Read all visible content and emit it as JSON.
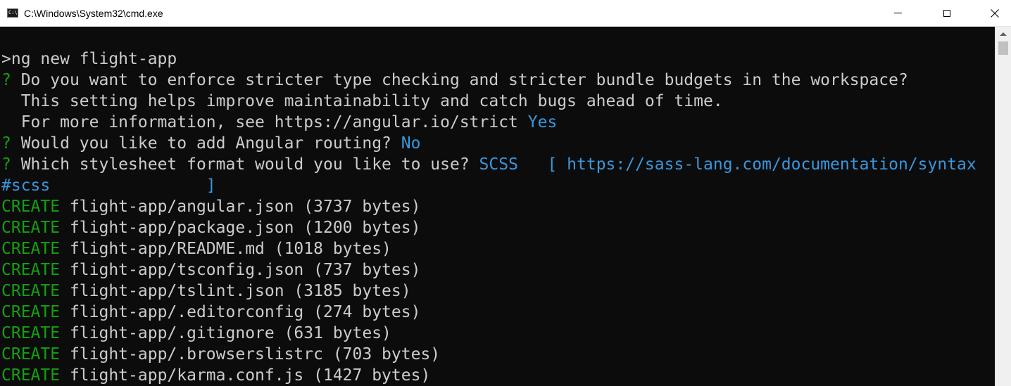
{
  "window": {
    "title": "C:\\Windows\\System32\\cmd.exe",
    "icon_label": "C:\\."
  },
  "console": {
    "lines": [
      [
        {
          "t": ">ng new flight-app",
          "c": "white"
        }
      ],
      [
        {
          "t": "? ",
          "c": "green"
        },
        {
          "t": "Do you want to enforce stricter type checking and stricter bundle budgets in the workspace?",
          "c": "white"
        }
      ],
      [
        {
          "t": "  This setting helps improve maintainability and catch bugs ahead of time.",
          "c": "white"
        }
      ],
      [
        {
          "t": "  For more information, see https://angular.io/strict ",
          "c": "white"
        },
        {
          "t": "Yes",
          "c": "blue"
        }
      ],
      [
        {
          "t": "? ",
          "c": "green"
        },
        {
          "t": "Would you like to add Angular routing? ",
          "c": "white"
        },
        {
          "t": "No",
          "c": "blue"
        }
      ],
      [
        {
          "t": "? ",
          "c": "green"
        },
        {
          "t": "Which stylesheet format would you like to use? ",
          "c": "white"
        },
        {
          "t": "SCSS   [ https://sass-lang.com/documentation/syntax",
          "c": "blue"
        }
      ],
      [
        {
          "t": "#scss                ]",
          "c": "blue"
        }
      ],
      [
        {
          "t": "CREATE",
          "c": "green"
        },
        {
          "t": " flight-app/angular.json (3737 bytes)",
          "c": "white"
        }
      ],
      [
        {
          "t": "CREATE",
          "c": "green"
        },
        {
          "t": " flight-app/package.json (1200 bytes)",
          "c": "white"
        }
      ],
      [
        {
          "t": "CREATE",
          "c": "green"
        },
        {
          "t": " flight-app/README.md (1018 bytes)",
          "c": "white"
        }
      ],
      [
        {
          "t": "CREATE",
          "c": "green"
        },
        {
          "t": " flight-app/tsconfig.json (737 bytes)",
          "c": "white"
        }
      ],
      [
        {
          "t": "CREATE",
          "c": "green"
        },
        {
          "t": " flight-app/tslint.json (3185 bytes)",
          "c": "white"
        }
      ],
      [
        {
          "t": "CREATE",
          "c": "green"
        },
        {
          "t": " flight-app/.editorconfig (274 bytes)",
          "c": "white"
        }
      ],
      [
        {
          "t": "CREATE",
          "c": "green"
        },
        {
          "t": " flight-app/.gitignore (631 bytes)",
          "c": "white"
        }
      ],
      [
        {
          "t": "CREATE",
          "c": "green"
        },
        {
          "t": " flight-app/.browserslistrc (703 bytes)",
          "c": "white"
        }
      ],
      [
        {
          "t": "CREATE",
          "c": "green"
        },
        {
          "t": " flight-app/karma.conf.js (1427 bytes)",
          "c": "white"
        }
      ]
    ]
  },
  "colors": {
    "background": "#0c0c0c",
    "white": "#cccccc",
    "green": "#13a10e",
    "blue": "#3a96dd"
  },
  "icons": {
    "app": "cmd-icon",
    "minimize": "minimize-icon",
    "maximize": "maximize-icon",
    "close": "close-icon",
    "scroll_up": "scroll-up-arrow-icon"
  }
}
